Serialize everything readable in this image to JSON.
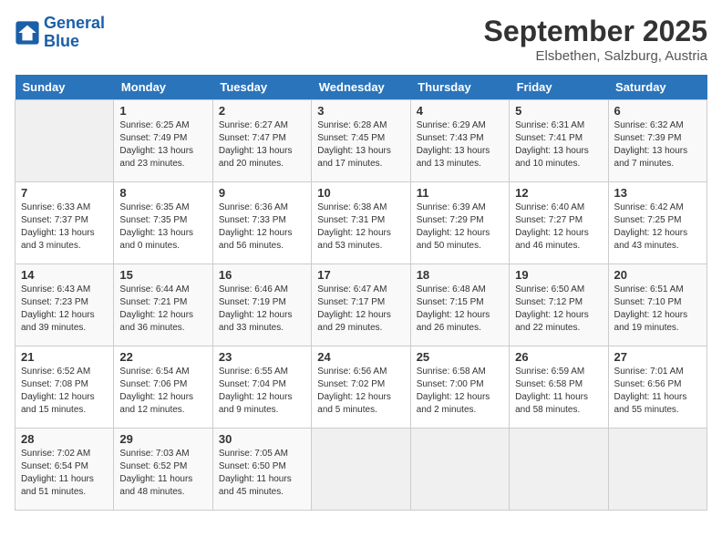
{
  "header": {
    "logo_line1": "General",
    "logo_line2": "Blue",
    "month": "September 2025",
    "location": "Elsbethen, Salzburg, Austria"
  },
  "weekdays": [
    "Sunday",
    "Monday",
    "Tuesday",
    "Wednesday",
    "Thursday",
    "Friday",
    "Saturday"
  ],
  "weeks": [
    [
      {
        "day": "",
        "info": ""
      },
      {
        "day": "1",
        "info": "Sunrise: 6:25 AM\nSunset: 7:49 PM\nDaylight: 13 hours\nand 23 minutes."
      },
      {
        "day": "2",
        "info": "Sunrise: 6:27 AM\nSunset: 7:47 PM\nDaylight: 13 hours\nand 20 minutes."
      },
      {
        "day": "3",
        "info": "Sunrise: 6:28 AM\nSunset: 7:45 PM\nDaylight: 13 hours\nand 17 minutes."
      },
      {
        "day": "4",
        "info": "Sunrise: 6:29 AM\nSunset: 7:43 PM\nDaylight: 13 hours\nand 13 minutes."
      },
      {
        "day": "5",
        "info": "Sunrise: 6:31 AM\nSunset: 7:41 PM\nDaylight: 13 hours\nand 10 minutes."
      },
      {
        "day": "6",
        "info": "Sunrise: 6:32 AM\nSunset: 7:39 PM\nDaylight: 13 hours\nand 7 minutes."
      }
    ],
    [
      {
        "day": "7",
        "info": "Sunrise: 6:33 AM\nSunset: 7:37 PM\nDaylight: 13 hours\nand 3 minutes."
      },
      {
        "day": "8",
        "info": "Sunrise: 6:35 AM\nSunset: 7:35 PM\nDaylight: 13 hours\nand 0 minutes."
      },
      {
        "day": "9",
        "info": "Sunrise: 6:36 AM\nSunset: 7:33 PM\nDaylight: 12 hours\nand 56 minutes."
      },
      {
        "day": "10",
        "info": "Sunrise: 6:38 AM\nSunset: 7:31 PM\nDaylight: 12 hours\nand 53 minutes."
      },
      {
        "day": "11",
        "info": "Sunrise: 6:39 AM\nSunset: 7:29 PM\nDaylight: 12 hours\nand 50 minutes."
      },
      {
        "day": "12",
        "info": "Sunrise: 6:40 AM\nSunset: 7:27 PM\nDaylight: 12 hours\nand 46 minutes."
      },
      {
        "day": "13",
        "info": "Sunrise: 6:42 AM\nSunset: 7:25 PM\nDaylight: 12 hours\nand 43 minutes."
      }
    ],
    [
      {
        "day": "14",
        "info": "Sunrise: 6:43 AM\nSunset: 7:23 PM\nDaylight: 12 hours\nand 39 minutes."
      },
      {
        "day": "15",
        "info": "Sunrise: 6:44 AM\nSunset: 7:21 PM\nDaylight: 12 hours\nand 36 minutes."
      },
      {
        "day": "16",
        "info": "Sunrise: 6:46 AM\nSunset: 7:19 PM\nDaylight: 12 hours\nand 33 minutes."
      },
      {
        "day": "17",
        "info": "Sunrise: 6:47 AM\nSunset: 7:17 PM\nDaylight: 12 hours\nand 29 minutes."
      },
      {
        "day": "18",
        "info": "Sunrise: 6:48 AM\nSunset: 7:15 PM\nDaylight: 12 hours\nand 26 minutes."
      },
      {
        "day": "19",
        "info": "Sunrise: 6:50 AM\nSunset: 7:12 PM\nDaylight: 12 hours\nand 22 minutes."
      },
      {
        "day": "20",
        "info": "Sunrise: 6:51 AM\nSunset: 7:10 PM\nDaylight: 12 hours\nand 19 minutes."
      }
    ],
    [
      {
        "day": "21",
        "info": "Sunrise: 6:52 AM\nSunset: 7:08 PM\nDaylight: 12 hours\nand 15 minutes."
      },
      {
        "day": "22",
        "info": "Sunrise: 6:54 AM\nSunset: 7:06 PM\nDaylight: 12 hours\nand 12 minutes."
      },
      {
        "day": "23",
        "info": "Sunrise: 6:55 AM\nSunset: 7:04 PM\nDaylight: 12 hours\nand 9 minutes."
      },
      {
        "day": "24",
        "info": "Sunrise: 6:56 AM\nSunset: 7:02 PM\nDaylight: 12 hours\nand 5 minutes."
      },
      {
        "day": "25",
        "info": "Sunrise: 6:58 AM\nSunset: 7:00 PM\nDaylight: 12 hours\nand 2 minutes."
      },
      {
        "day": "26",
        "info": "Sunrise: 6:59 AM\nSunset: 6:58 PM\nDaylight: 11 hours\nand 58 minutes."
      },
      {
        "day": "27",
        "info": "Sunrise: 7:01 AM\nSunset: 6:56 PM\nDaylight: 11 hours\nand 55 minutes."
      }
    ],
    [
      {
        "day": "28",
        "info": "Sunrise: 7:02 AM\nSunset: 6:54 PM\nDaylight: 11 hours\nand 51 minutes."
      },
      {
        "day": "29",
        "info": "Sunrise: 7:03 AM\nSunset: 6:52 PM\nDaylight: 11 hours\nand 48 minutes."
      },
      {
        "day": "30",
        "info": "Sunrise: 7:05 AM\nSunset: 6:50 PM\nDaylight: 11 hours\nand 45 minutes."
      },
      {
        "day": "",
        "info": ""
      },
      {
        "day": "",
        "info": ""
      },
      {
        "day": "",
        "info": ""
      },
      {
        "day": "",
        "info": ""
      }
    ]
  ]
}
